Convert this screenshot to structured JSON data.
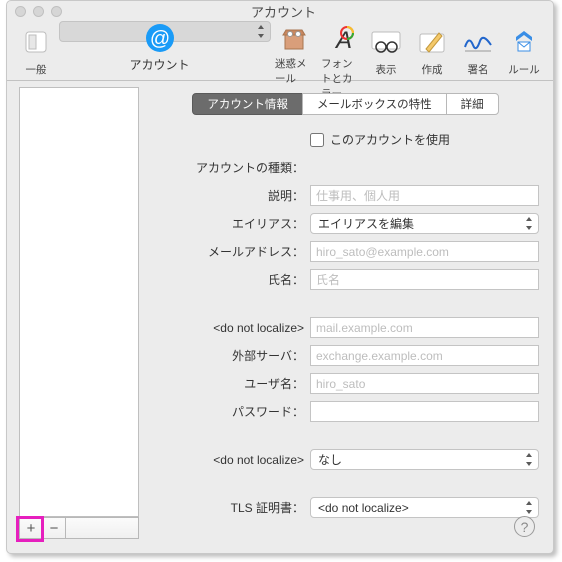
{
  "window": {
    "title": "アカウント"
  },
  "toolbar": [
    {
      "label": "一般",
      "name": "general"
    },
    {
      "label": "アカウント",
      "name": "accounts",
      "selected": true
    },
    {
      "label": "迷惑メール",
      "name": "junk"
    },
    {
      "label": "フォントとカラー",
      "name": "fonts"
    },
    {
      "label": "表示",
      "name": "viewing"
    },
    {
      "label": "作成",
      "name": "composing"
    },
    {
      "label": "署名",
      "name": "signatures"
    },
    {
      "label": "ルール",
      "name": "rules"
    }
  ],
  "tabs": {
    "info": "アカウント情報",
    "mailbox": "メールボックスの特性",
    "advanced": "詳細"
  },
  "form": {
    "enable_label": "このアカウントを使用",
    "type_label": "アカウントの種類：",
    "desc_label": "説明：",
    "desc_ph": "仕事用、個人用",
    "alias_label": "エイリアス：",
    "alias_value": "エイリアスを編集",
    "email_label": "メールアドレス：",
    "email_ph": "hiro_sato@example.com",
    "fullname_label": "氏名：",
    "fullname_ph": "氏名",
    "dnl1_label": "<do not localize>",
    "dnl1_ph": "mail.example.com",
    "ext_label": "外部サーバ：",
    "ext_ph": "exchange.example.com",
    "user_label": "ユーザ名：",
    "user_ph": "hiro_sato",
    "pass_label": "パスワード：",
    "dnl2_label": "<do not localize>",
    "dnl2_value": "なし",
    "tls_label": "TLS 証明書：",
    "tls_value": "<do not localize>"
  },
  "buttons": {
    "add": "+",
    "remove": "−",
    "help": "?"
  }
}
